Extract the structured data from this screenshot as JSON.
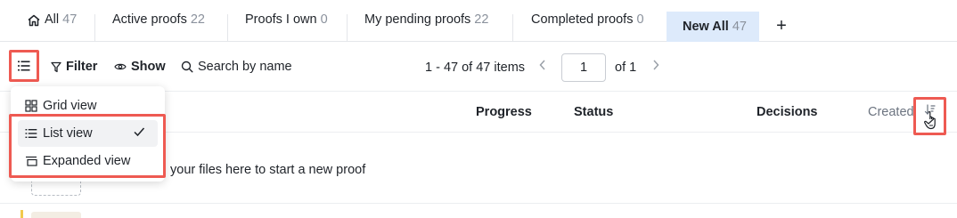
{
  "tabs": [
    {
      "label": "All",
      "count": "47",
      "icon": "home-icon"
    },
    {
      "label": "Active proofs",
      "count": "22"
    },
    {
      "label": "Proofs I own",
      "count": "0"
    },
    {
      "label": "My pending proofs",
      "count": "22"
    },
    {
      "label": "Completed proofs",
      "count": "0"
    },
    {
      "label": "New All",
      "count": "47",
      "active": true
    }
  ],
  "add_tab_label": "+",
  "toolbar": {
    "filter_label": "Filter",
    "show_label": "Show",
    "search_placeholder": "Search by name",
    "pager_summary": "1 - 47 of 47 items",
    "page_value": "1",
    "page_total": "of 1"
  },
  "columns": {
    "progress": "Progress",
    "status": "Status",
    "decisions": "Decisions",
    "created": "Created"
  },
  "view_menu": {
    "items": [
      {
        "label": "Grid view",
        "icon": "grid-icon"
      },
      {
        "label": "List view",
        "icon": "list-icon",
        "selected": true
      },
      {
        "label": "Expanded view",
        "icon": "expanded-view-icon"
      }
    ]
  },
  "drop_zone_text": "your files here to start a new proof",
  "colors": {
    "active_tab_bg": "#ddeafb",
    "highlight_red": "#ee5a52",
    "count_gray": "#8a919c"
  }
}
